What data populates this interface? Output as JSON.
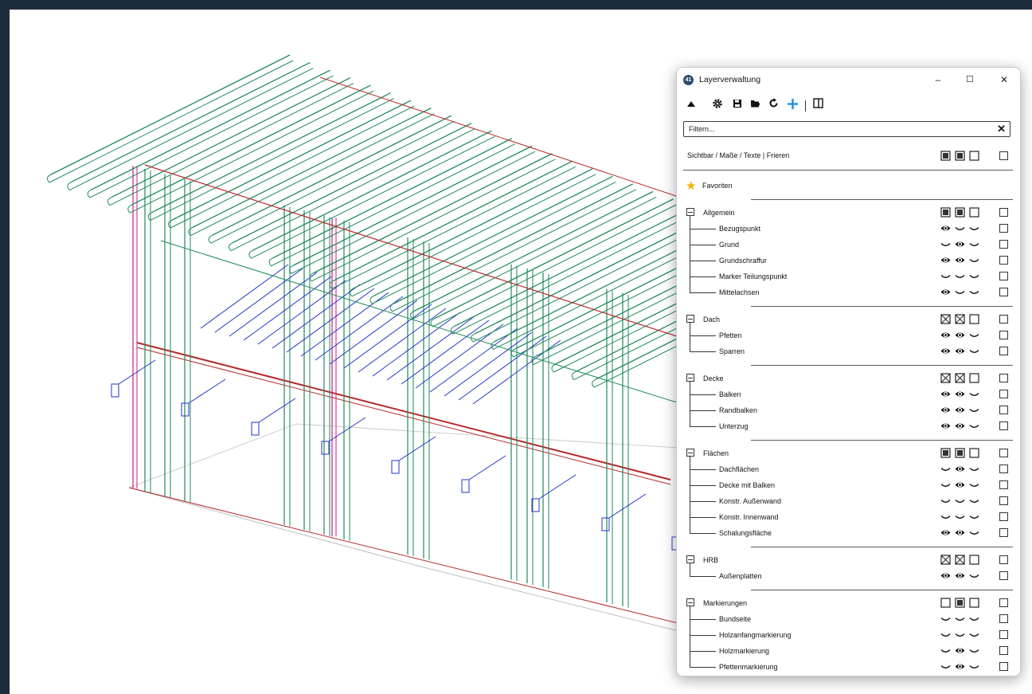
{
  "window": {
    "title": "Layerverwaltung",
    "app_icon_text": "41",
    "controls": {
      "minimize": "–",
      "maximize": "☐",
      "close": "✕"
    }
  },
  "toolbar": {
    "icons": [
      "collapse-up-icon",
      "gear-icon",
      "save-icon",
      "folder-open-icon",
      "refresh-icon",
      "add-icon",
      "panel-icon"
    ]
  },
  "filter": {
    "placeholder": "Filtern...",
    "clear": "✕"
  },
  "header": {
    "label": "Sichtbar / Maße / Texte  |  Frieren",
    "states": [
      "filled",
      "filled",
      "empty"
    ]
  },
  "favorites": {
    "label": "Favoriten"
  },
  "groups": [
    {
      "label": "Allgemein",
      "states": [
        "filled",
        "filled",
        "empty"
      ],
      "children": [
        {
          "label": "Bezugspunkt",
          "states": [
            "eye",
            "closed",
            "closed"
          ]
        },
        {
          "label": "Grund",
          "states": [
            "closed",
            "eye",
            "closed"
          ]
        },
        {
          "label": "Grundschraffur",
          "states": [
            "eye",
            "eye",
            "closed"
          ]
        },
        {
          "label": "Marker Teilungspunkt",
          "states": [
            "closed",
            "closed",
            "closed"
          ]
        },
        {
          "label": "Mittelachsen",
          "states": [
            "eye",
            "closed",
            "closed"
          ]
        }
      ]
    },
    {
      "label": "Dach",
      "states": [
        "cross",
        "cross",
        "empty"
      ],
      "children": [
        {
          "label": "Pfetten",
          "states": [
            "eye",
            "eye",
            "closed"
          ]
        },
        {
          "label": "Sparren",
          "states": [
            "eye",
            "eye",
            "closed"
          ]
        }
      ]
    },
    {
      "label": "Decke",
      "states": [
        "cross",
        "cross",
        "empty"
      ],
      "children": [
        {
          "label": "Balken",
          "states": [
            "eye",
            "eye",
            "closed"
          ]
        },
        {
          "label": "Randbalken",
          "states": [
            "eye",
            "eye",
            "closed"
          ]
        },
        {
          "label": "Unterzug",
          "states": [
            "eye",
            "eye",
            "closed"
          ]
        }
      ]
    },
    {
      "label": "Flächen",
      "states": [
        "filled",
        "filled",
        "empty"
      ],
      "children": [
        {
          "label": "Dachflächen",
          "states": [
            "closed",
            "eye",
            "closed"
          ]
        },
        {
          "label": "Decke mit Balken",
          "states": [
            "closed",
            "eye",
            "closed"
          ]
        },
        {
          "label": "Konstr. Außenwand",
          "states": [
            "closed",
            "closed",
            "closed"
          ]
        },
        {
          "label": "Konstr. Innenwand",
          "states": [
            "closed",
            "closed",
            "closed"
          ]
        },
        {
          "label": "Schalungsfläche",
          "states": [
            "eye",
            "eye",
            "closed"
          ]
        }
      ]
    },
    {
      "label": "HRB",
      "states": [
        "cross",
        "cross",
        "empty"
      ],
      "children": [
        {
          "label": "Außenplatten",
          "states": [
            "eye",
            "eye",
            "closed"
          ]
        }
      ]
    },
    {
      "label": "Markierungen",
      "states": [
        "empty",
        "filled",
        "empty"
      ],
      "children": [
        {
          "label": "Bundseite",
          "states": [
            "closed",
            "closed",
            "closed"
          ]
        },
        {
          "label": "Holzanfangmarkierung",
          "states": [
            "closed",
            "closed",
            "closed"
          ]
        },
        {
          "label": "Holzmarkierung",
          "states": [
            "closed",
            "eye",
            "closed"
          ]
        },
        {
          "label": "Pfettenmarkierung",
          "states": [
            "closed",
            "eye",
            "closed"
          ]
        }
      ]
    }
  ],
  "colors": {
    "background": "#1c2b3b",
    "viewport": "#ffffff",
    "timber_green": "#1e8a5a",
    "timber_red": "#b52b2b",
    "timber_blue": "#2233cc",
    "timber_magenta": "#d0198a",
    "favorite_star": "#f0b400"
  }
}
